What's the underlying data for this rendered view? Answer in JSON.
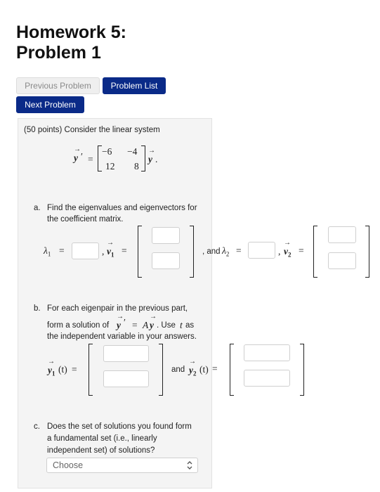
{
  "page": {
    "title_line1": "Homework 5:",
    "title_line2": "Problem 1"
  },
  "nav": {
    "previous": "Previous Problem",
    "list": "Problem List",
    "next": "Next Problem"
  },
  "problem": {
    "intro": "(50 points) Consider the linear system",
    "system": {
      "lhs": "y",
      "prime": "′",
      "equals": "=",
      "matrix": [
        [
          "−6",
          "−4"
        ],
        [
          "12",
          "8"
        ]
      ],
      "rhs": "y",
      "period": "."
    },
    "part_a": {
      "marker": "a.",
      "line1": "Find the eigenvalues and eigenvectors for",
      "line2": "the coefficient matrix.",
      "lambda1": "λ",
      "lambda1_sub": "1",
      "eq": "=",
      "comma": ",",
      "v1": "v",
      "v1_sub": "1",
      "and_text": ", and",
      "lambda2": "λ",
      "lambda2_sub": "2",
      "v2": "v",
      "v2_sub": "2",
      "inputs": {
        "lambda1": "",
        "v1_top": "",
        "v1_bottom": "",
        "lambda2": "",
        "v2_top": "",
        "v2_bottom": ""
      }
    },
    "part_b": {
      "marker": "b.",
      "line1": "For each eigenpair in the previous part,",
      "line2_pre": "form a solution of",
      "eq_y": "y",
      "eq_prime": "′",
      "eq_equals": "=",
      "eq_A": "A",
      "eq_y2": "y",
      "line2_mid": ". Use",
      "t": "t",
      "line2_post": "as",
      "line3": "the independent variable in your answers.",
      "y1": "y",
      "y1_sub": "1",
      "y1_arg": "(t)",
      "eq": "=",
      "and_text": "and",
      "y2": "y",
      "y2_sub": "2",
      "y2_arg": "(t)",
      "inputs": {
        "y1_top": "",
        "y1_bottom": "",
        "y2_top": "",
        "y2_bottom": ""
      }
    },
    "part_c": {
      "marker": "c.",
      "line1": "Does the set of solutions you found form",
      "line2": "a fundamental set (i.e., linearly",
      "line3": "independent set) of solutions?",
      "select_value": "Choose"
    }
  },
  "icons": {
    "select": "chevron-up-down-icon"
  },
  "colors": {
    "primary_button": "#0a2a88",
    "disabled_button": "#efefef",
    "panel": "#f4f4f4"
  }
}
